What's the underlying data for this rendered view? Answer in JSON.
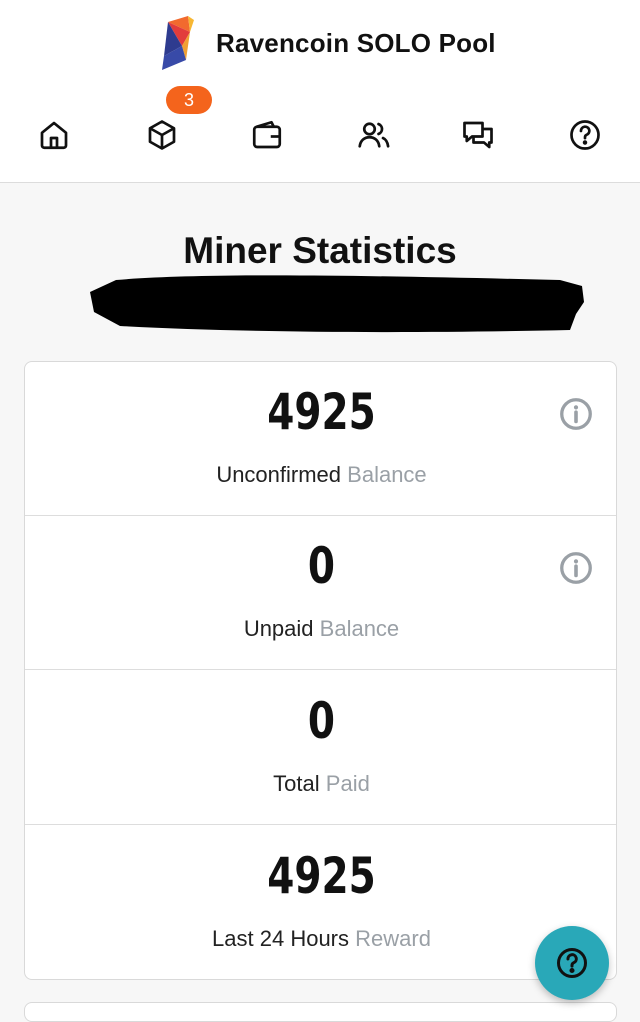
{
  "header": {
    "brand_title": "Ravencoin SOLO Pool",
    "nav": [
      {
        "id": "home",
        "icon": "home-icon"
      },
      {
        "id": "blocks",
        "icon": "cube-icon",
        "badge": "3"
      },
      {
        "id": "wallet",
        "icon": "wallet-icon"
      },
      {
        "id": "miners",
        "icon": "users-icon"
      },
      {
        "id": "chat",
        "icon": "chat-icon"
      },
      {
        "id": "help",
        "icon": "help-circle-icon"
      }
    ]
  },
  "main": {
    "title": "Miner Statistics",
    "stats": [
      {
        "value": "4925",
        "label_main": "Unconfirmed",
        "label_muted": "Balance",
        "has_info": true
      },
      {
        "value": "0",
        "label_main": "Unpaid",
        "label_muted": "Balance",
        "has_info": true
      },
      {
        "value": "0",
        "label_main": "Total",
        "label_muted": "Paid",
        "has_info": false
      },
      {
        "value": "4925",
        "label_main": "Last 24 Hours",
        "label_muted": "Reward",
        "has_info": false
      }
    ]
  },
  "colors": {
    "badge": "#f4641c",
    "help_fab": "#29a8b8",
    "muted_text": "#9aa0a6",
    "info_icon": "#9aa0a6"
  }
}
